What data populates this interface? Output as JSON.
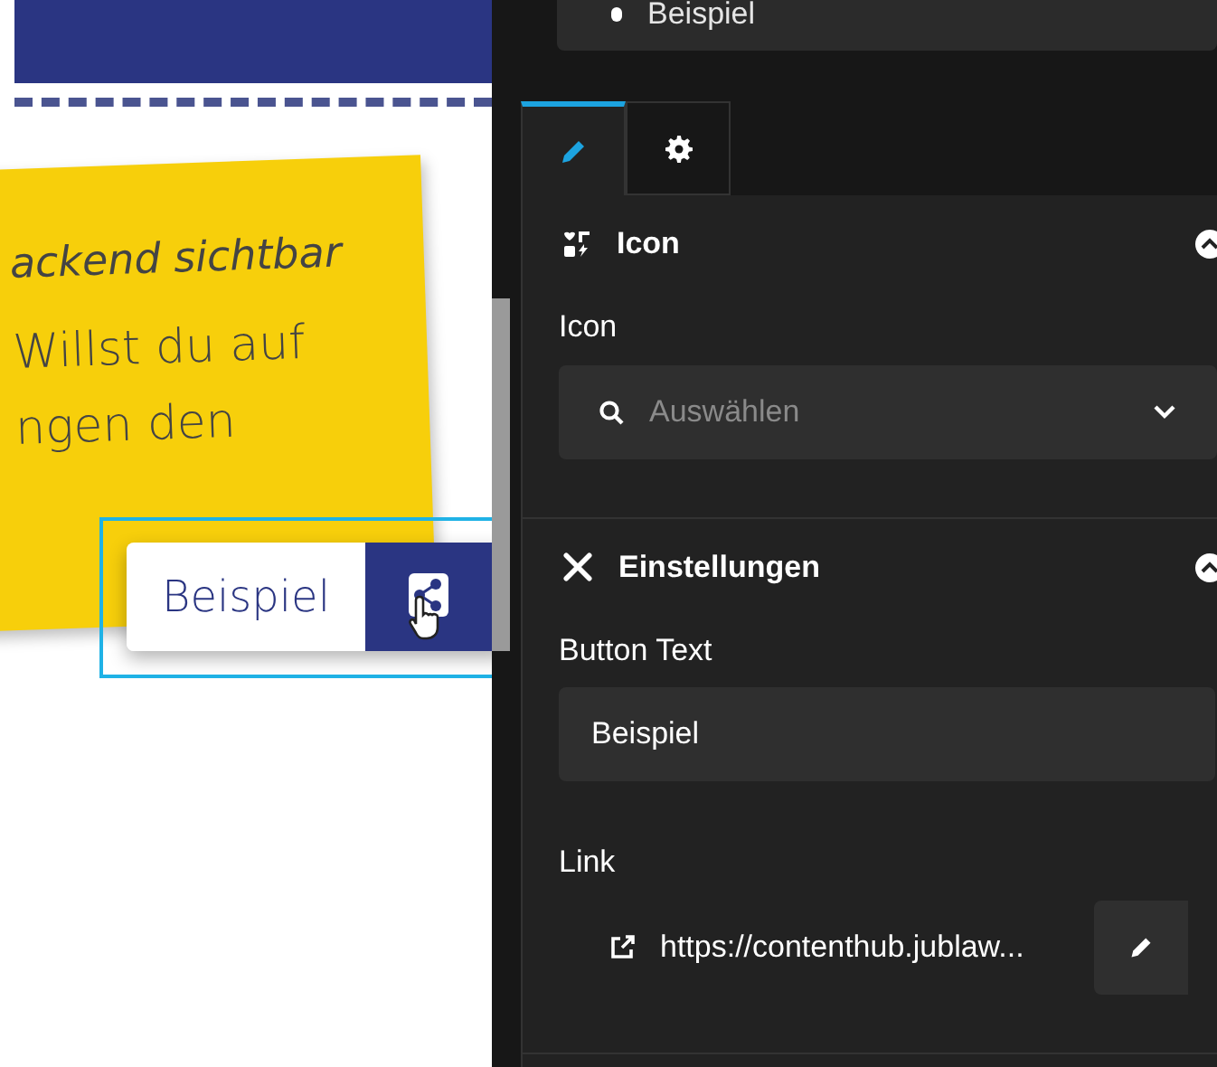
{
  "top_field": {
    "value": "Beispiel"
  },
  "preview": {
    "note_lines": [
      {
        "text": "ackend sichtbar",
        "kind": "caption"
      },
      {
        "text": "Willst du auf",
        "kind": "body"
      },
      {
        "text": "ngen den",
        "kind": "body"
      }
    ],
    "button": {
      "label": "Beispiel"
    }
  },
  "tabs": [
    {
      "kind": "content",
      "selected": true
    },
    {
      "kind": "settings",
      "selected": false
    }
  ],
  "sections": [
    {
      "kind": "icon",
      "title": "Icon",
      "expanded": true,
      "fields": [
        {
          "kind": "select",
          "label": "Icon",
          "placeholder": "Auswählen"
        }
      ]
    },
    {
      "kind": "settings",
      "title": "Einstellungen",
      "expanded": true,
      "fields": [
        {
          "kind": "text",
          "label": "Button Text",
          "value": "Beispiel"
        },
        {
          "kind": "link",
          "label": "Link",
          "value": "https://contenthub.jublaw..."
        }
      ]
    }
  ]
}
